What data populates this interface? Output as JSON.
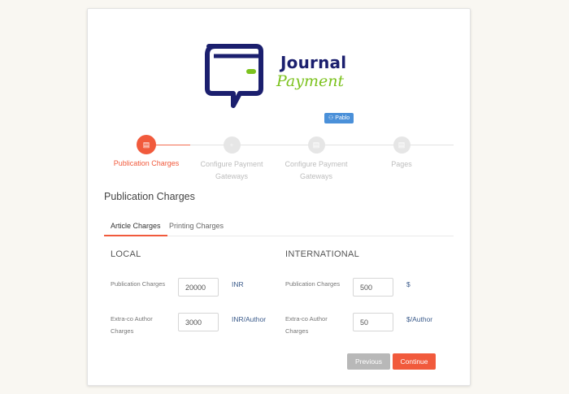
{
  "logo": {
    "line1": "Journal",
    "line2": "Payment"
  },
  "user_badge": {
    "icon": "user-icon",
    "name": "Pablo"
  },
  "steps": [
    {
      "label": "Publication Charges",
      "icon": "card-icon",
      "active": true
    },
    {
      "label": "Configure Payment Gateways",
      "icon": "doc-icon",
      "active": false
    },
    {
      "label": "Configure Payment Gateways",
      "icon": "doc-icon",
      "active": false
    },
    {
      "label": "Pages",
      "icon": "doc-icon",
      "active": false
    }
  ],
  "section_title": "Publication Charges",
  "tabs": [
    {
      "label": "Article Charges",
      "active": true
    },
    {
      "label": "Printing Charges",
      "active": false
    }
  ],
  "local": {
    "title": "LOCAL",
    "publication_label": "Publication Charges",
    "publication_value": "20000",
    "publication_unit": "INR",
    "extra_label": "Extra-co Author Charges",
    "extra_value": "3000",
    "extra_unit": "INR/Author"
  },
  "international": {
    "title": "INTERNATIONAL",
    "publication_label": "Publication Charges",
    "publication_value": "500",
    "publication_unit": "$",
    "extra_label": "Extra-co Author Charges",
    "extra_value": "50",
    "extra_unit": "$/Author"
  },
  "buttons": {
    "previous": "Previous",
    "continue": "Continue"
  },
  "colors": {
    "accent": "#f15a3c",
    "logo_navy": "#1b1f6e",
    "logo_green": "#7cc21e",
    "badge": "#4a90d9"
  }
}
